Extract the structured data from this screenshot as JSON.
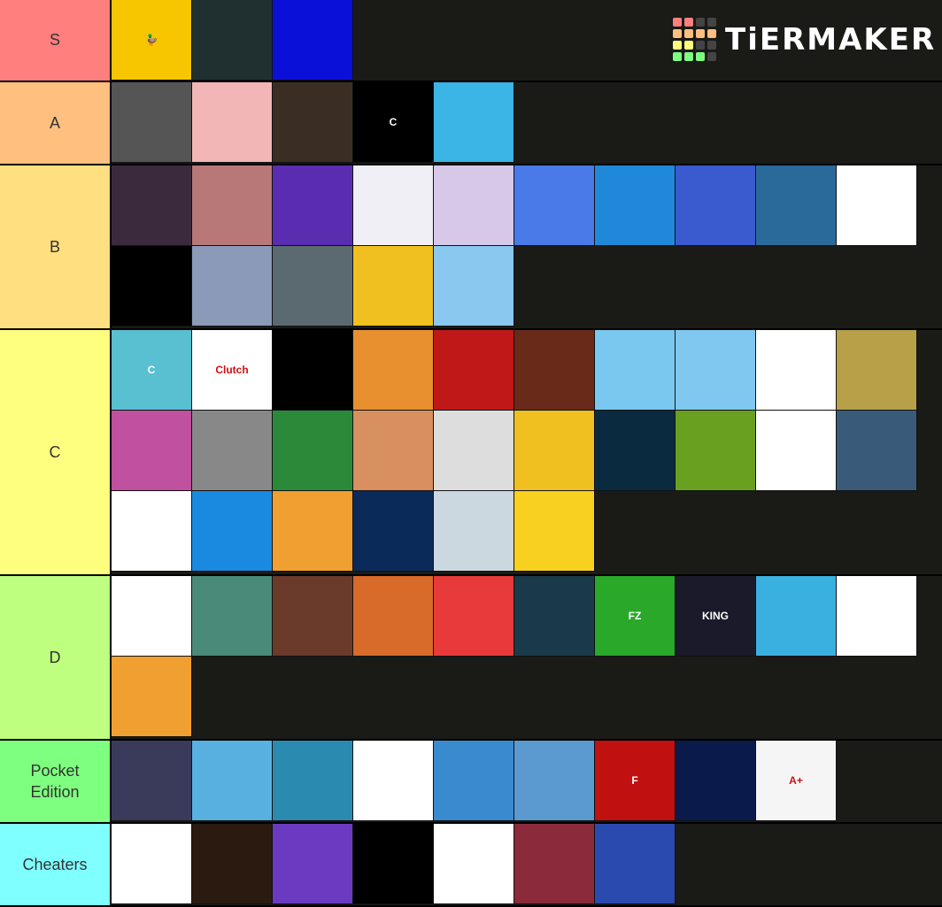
{
  "brand": {
    "name": "TiERMAKER",
    "grid_colors": [
      "#ff7f7f",
      "#ff7f7f",
      "#444",
      "#444",
      "#ffbf7f",
      "#ffbf7f",
      "#ffbf7f",
      "#ffbf7f",
      "#ffff7f",
      "#ffff7f",
      "#444",
      "#444",
      "#7fff7f",
      "#7fff7f",
      "#7fff7f",
      "#444"
    ]
  },
  "tiers": [
    {
      "label": "S",
      "color": "#ff7f7f",
      "rows": 1,
      "items": [
        {
          "name": "duck-avatar",
          "bg": "#f7c600",
          "text": "🦆"
        },
        {
          "name": "anime-spiky-hair-avatar",
          "bg": "#203030",
          "text": ""
        },
        {
          "name": "blue-square-avatar",
          "bg": "#0a10d8",
          "text": ""
        }
      ]
    },
    {
      "label": "A",
      "color": "#ffbf7f",
      "rows": 1,
      "items": [
        {
          "name": "ninja-helmet-avatar",
          "bg": "#555",
          "text": ""
        },
        {
          "name": "finn-avatar",
          "bg": "#f2b6b6",
          "text": ""
        },
        {
          "name": "cow-skin-avatar",
          "bg": "#3a2e24",
          "text": ""
        },
        {
          "name": "c-logo-avatar",
          "bg": "#000",
          "text": "C"
        },
        {
          "name": "gingerbread-avatar",
          "bg": "#3ab5e6",
          "text": ""
        }
      ]
    },
    {
      "label": "B",
      "color": "#ffdf7f",
      "rows": 2,
      "items": [
        {
          "name": "anime-girl-avatar",
          "bg": "#3b2a3e",
          "text": ""
        },
        {
          "name": "pink-hat-avatar",
          "bg": "#b87878",
          "text": ""
        },
        {
          "name": "lemur-avatar",
          "bg": "#5a2db0",
          "text": ""
        },
        {
          "name": "purple-cube-avatar",
          "bg": "#efeff5",
          "text": ""
        },
        {
          "name": "cat-hood-avatar",
          "bg": "#d8c8e8",
          "text": ""
        },
        {
          "name": "blue-block-avatar",
          "bg": "#4a7ae8",
          "text": ""
        },
        {
          "name": "red-face-gamer-avatar",
          "bg": "#1f88d8",
          "text": ""
        },
        {
          "name": "crown-skin-avatar",
          "bg": "#3a5ad0",
          "text": ""
        },
        {
          "name": "seal-photo-avatar",
          "bg": "#2a6a9a",
          "text": ""
        },
        {
          "name": "purple-hair-mask-avatar",
          "bg": "#fff",
          "text": ""
        },
        {
          "name": "black-avatar",
          "bg": "#000",
          "text": ""
        },
        {
          "name": "anime-street-avatar",
          "bg": "#8a9ab8",
          "text": ""
        },
        {
          "name": "mirror-selfie-avatar",
          "bg": "#5a6a70",
          "text": ""
        },
        {
          "name": "headphones-mask-avatar",
          "bg": "#f0c020",
          "text": ""
        },
        {
          "name": "green-slime-avatar",
          "bg": "#8ac8f0",
          "text": ""
        }
      ]
    },
    {
      "label": "C",
      "color": "#ffff7f",
      "rows": 3,
      "items": [
        {
          "name": "c-landscape-avatar",
          "bg": "#58c0d0",
          "text": "C"
        },
        {
          "name": "clutch-sos-avatar",
          "bg": "#fff",
          "text": "Clutch"
        },
        {
          "name": "black-avatar",
          "bg": "#000",
          "text": ""
        },
        {
          "name": "orange-block-avatar",
          "bg": "#e89030",
          "text": ""
        },
        {
          "name": "red-demon-skin-avatar",
          "bg": "#c01818",
          "text": ""
        },
        {
          "name": "flaming-sword-avatar",
          "bg": "#6a2a1a",
          "text": ""
        },
        {
          "name": "top-hat-ghost-avatar",
          "bg": "#7ac8f0",
          "text": ""
        },
        {
          "name": "bunny-avatar",
          "bg": "#80c8f0",
          "text": ""
        },
        {
          "name": "white-avatar",
          "bg": "#fff",
          "text": ""
        },
        {
          "name": "blonde-skin-avatar",
          "bg": "#b8a048",
          "text": ""
        },
        {
          "name": "anime-boy-red-avatar",
          "bg": "#c050a0",
          "text": ""
        },
        {
          "name": "bw-girl-avatar",
          "bg": "#888",
          "text": ""
        },
        {
          "name": "cartoon-boy-avatar",
          "bg": "#2a8a3a",
          "text": ""
        },
        {
          "name": "fox-girl-avatar",
          "bg": "#d89060",
          "text": ""
        },
        {
          "name": "green-hoodie-skin-avatar",
          "bg": "#ddd",
          "text": ""
        },
        {
          "name": "masked-gamer-avatar",
          "bg": "#f0c020",
          "text": ""
        },
        {
          "name": "tornado-logo-avatar",
          "bg": "#0a2a40",
          "text": ""
        },
        {
          "name": "boy-red-shirt-avatar",
          "bg": "#6aa020",
          "text": ""
        },
        {
          "name": "white-avatar-2",
          "bg": "#fff",
          "text": ""
        },
        {
          "name": "diamond-logo-avatar",
          "bg": "#3a5a7a",
          "text": ""
        },
        {
          "name": "faceless-avatar",
          "bg": "#fff",
          "text": ""
        },
        {
          "name": "sunglasses-skin-avatar",
          "bg": "#1a8ae0",
          "text": ""
        },
        {
          "name": "white-block-avatar",
          "bg": "#f0a030",
          "text": ""
        },
        {
          "name": "nyan-pig-avatar",
          "bg": "#0a2a5a",
          "text": ""
        },
        {
          "name": "polar-bear-avatar",
          "bg": "#ccd8e0",
          "text": ""
        },
        {
          "name": "yellow-block-face-avatar",
          "bg": "#f8d020",
          "text": ""
        }
      ]
    },
    {
      "label": "D",
      "color": "#bfff7f",
      "rows": 2,
      "items": [
        {
          "name": "darkrai-avatar",
          "bg": "#fff",
          "text": ""
        },
        {
          "name": "seal-avatar",
          "bg": "#4a8a78",
          "text": ""
        },
        {
          "name": "brown-skin-avatar",
          "bg": "#6a3a2a",
          "text": ""
        },
        {
          "name": "pizza-cartoon-avatar",
          "bg": "#d86a2a",
          "text": ""
        },
        {
          "name": "glasses-cartoon-avatar",
          "bg": "#e83a3a",
          "text": ""
        },
        {
          "name": "green-laugh-avatar",
          "bg": "#1a3a4a",
          "text": ""
        },
        {
          "name": "fz-logo-avatar",
          "bg": "#2aa82a",
          "text": "FZ"
        },
        {
          "name": "king-jones-avatar",
          "bg": "#1a1a2a",
          "text": "KING"
        },
        {
          "name": "wink-boy-avatar",
          "bg": "#3ab0e0",
          "text": ""
        },
        {
          "name": "lemon-man-avatar",
          "bg": "#fff",
          "text": ""
        },
        {
          "name": "angry-boy-avatar",
          "bg": "#f0a030",
          "text": ""
        }
      ]
    },
    {
      "label": "Pocket\nEdition",
      "color": "#7fff7f",
      "rows": 1,
      "items": [
        {
          "name": "horned-alien-avatar",
          "bg": "#3a3a5a",
          "text": ""
        },
        {
          "name": "purple-cat-avatar",
          "bg": "#58b0e0",
          "text": ""
        },
        {
          "name": "vegeta-avatar",
          "bg": "#2a8ab0",
          "text": ""
        },
        {
          "name": "suit-skin-avatar",
          "bg": "#fff",
          "text": ""
        },
        {
          "name": "panda-crown-avatar",
          "bg": "#3a8ad0",
          "text": ""
        },
        {
          "name": "bear-cartoon-avatar",
          "bg": "#5a9ad0",
          "text": ""
        },
        {
          "name": "red-f-logo-avatar",
          "bg": "#c01010",
          "text": "F"
        },
        {
          "name": "blue-robot-avatar",
          "bg": "#0a1a4a",
          "text": ""
        },
        {
          "name": "a-plus-avatar",
          "bg": "#f5f5f5",
          "text": "A+"
        }
      ]
    },
    {
      "label": "Cheaters",
      "color": "#7fffff",
      "rows": 1,
      "items": [
        {
          "name": "cow-cartoon-avatar",
          "bg": "#fff",
          "text": ""
        },
        {
          "name": "sunglasses-man-avatar",
          "bg": "#2a1a10",
          "text": ""
        },
        {
          "name": "purple-gamer-skin-avatar",
          "bg": "#6a3ac0",
          "text": ""
        },
        {
          "name": "enderman-avatar",
          "bg": "#000",
          "text": ""
        },
        {
          "name": "white-avatar-3",
          "bg": "#fff",
          "text": ""
        },
        {
          "name": "red-demon-avatar",
          "bg": "#8a2a3a",
          "text": ""
        },
        {
          "name": "crowned-boy-avatar",
          "bg": "#2a4ab0",
          "text": ""
        }
      ]
    }
  ]
}
